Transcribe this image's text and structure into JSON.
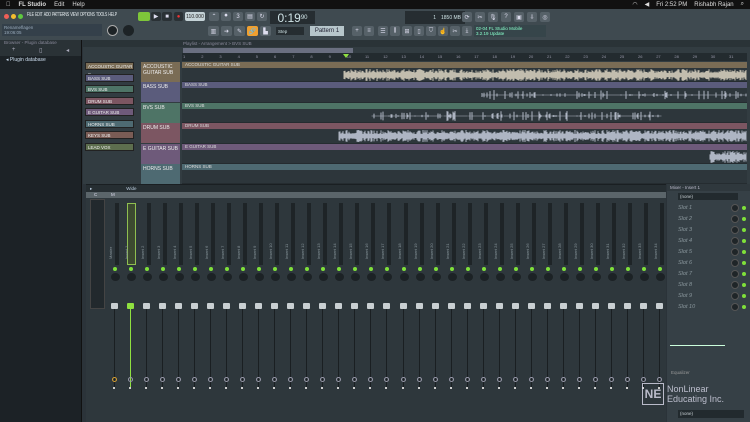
{
  "menubar": {
    "app": "FL Studio",
    "items": [
      "Edit",
      "Help"
    ],
    "clock": "Fri 2:52 PM",
    "user": "Rishabh Rajan"
  },
  "toolbar": {
    "menu": [
      "FILE",
      "EDIT",
      "ADD",
      "PATTERNS",
      "VIEW",
      "OPTIONS",
      "TOOLS",
      "HELP"
    ],
    "tempo": "110.000",
    "time": "0:19",
    "time_sub": "90",
    "hint_title": "Renameflagen",
    "hint_sub": "19:06:05",
    "snap": "Step",
    "pattern": "Pattern 1",
    "cpu": "1",
    "mem": "1850 MB",
    "poly": "0",
    "news": "02-04  FL Studio Mobile",
    "news2": "3.2.19 Update"
  },
  "browser": {
    "title": "Plugin database",
    "crumb": "Browser - Plugin database"
  },
  "playlist": {
    "crumb": "Playlist - Arrangement > BVS SUB",
    "ruler": [
      "1",
      "2",
      "3",
      "4",
      "5",
      "6",
      "7",
      "8",
      "9",
      "10",
      "11",
      "12",
      "13",
      "14",
      "15",
      "16",
      "17",
      "18",
      "19",
      "20",
      "21",
      "22",
      "23",
      "24",
      "25",
      "26",
      "27",
      "28",
      "29",
      "30",
      "31"
    ],
    "tracks": [
      {
        "name": "ACCOUSTIC GUITAR SUB",
        "clip": "ACCOUSTIC GUITAR SUB",
        "color": "#7a6c55"
      },
      {
        "name": "BASS SUB",
        "clip": "BASS SUB",
        "color": "#5b5c7c"
      },
      {
        "name": "BVS SUB",
        "clip": "BVS SUB",
        "color": "#4e7466"
      },
      {
        "name": "DRUM SUB",
        "clip": "DRUM SUB",
        "color": "#7c5662"
      },
      {
        "name": "E GUITAR SUB",
        "clip": "E GUITAR SUB",
        "color": "#6e5a7a"
      },
      {
        "name": "HORNS SUB",
        "clip": "HORNS SUB",
        "color": "#4e6a72"
      }
    ],
    "rack": [
      {
        "name": "ACCOUSTIC GUITAR S..",
        "color": "#7a6c55"
      },
      {
        "name": "BASS SUB",
        "color": "#5b5c7c"
      },
      {
        "name": "BVS SUB",
        "color": "#4e7466"
      },
      {
        "name": "DRUM SUB",
        "color": "#7c5662"
      },
      {
        "name": "E GUITAR SUB",
        "color": "#6e5a7a"
      },
      {
        "name": "HORNS SUB",
        "color": "#4e6a72"
      },
      {
        "name": "KEYS SUB",
        "color": "#7a5c55"
      },
      {
        "name": "LEAD VOX",
        "color": "#5d6e4e"
      }
    ]
  },
  "mixer": {
    "title": "Wide",
    "current": "Master",
    "header_c": "C",
    "header_m": "M",
    "inserts": 34
  },
  "insert_panel": {
    "title": "Mixer - Insert 1",
    "preset": "(none)",
    "slots": [
      "Slot 1",
      "Slot 2",
      "Slot 3",
      "Slot 4",
      "Slot 5",
      "Slot 6",
      "Slot 7",
      "Slot 8",
      "Slot 9",
      "Slot 10"
    ],
    "eq": "Equalizer",
    "output": "(none)"
  },
  "watermark": {
    "logo": "NE",
    "line1": "NonLinear",
    "line2": "Educating Inc."
  }
}
